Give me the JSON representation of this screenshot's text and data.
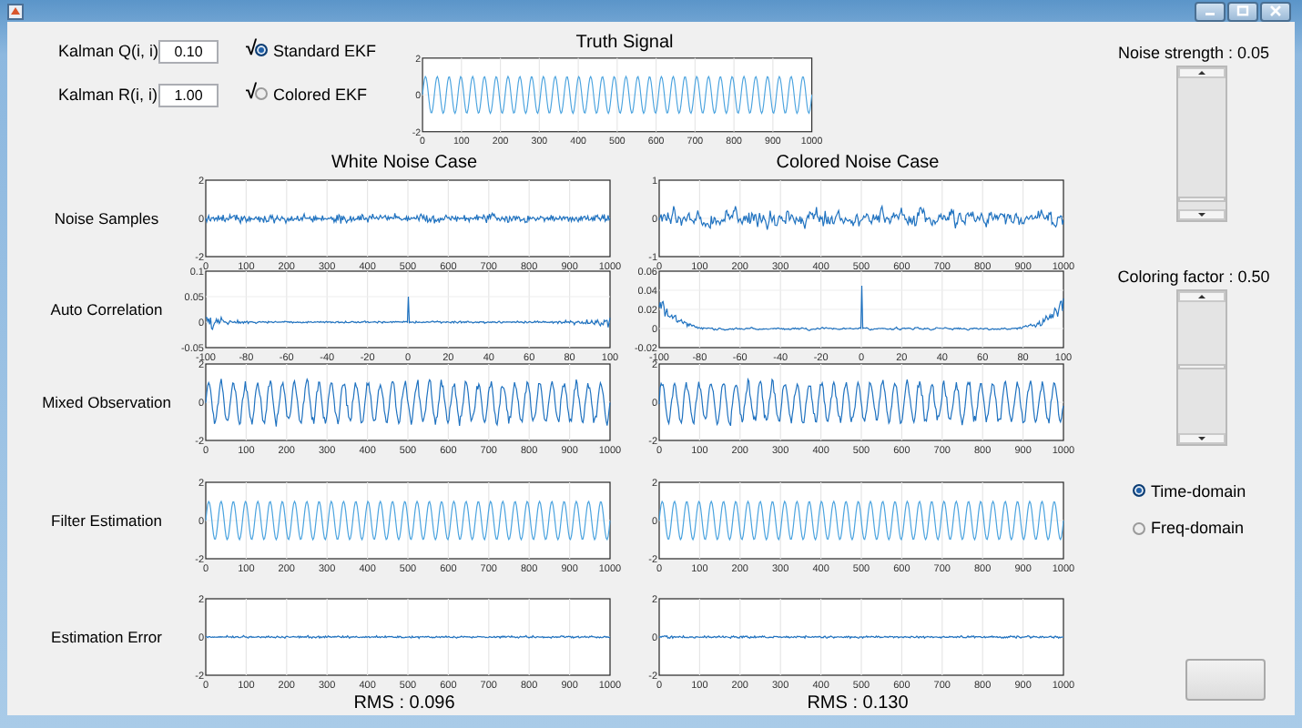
{
  "settings": [
    {
      "label": "Kalman Q(i, i)",
      "value": "0.10",
      "mark": "√"
    },
    {
      "label": "Kalman R(i, i)",
      "value": "1.00",
      "mark": "√"
    }
  ],
  "filter_options": [
    {
      "label": "Standard EKF",
      "selected": true
    },
    {
      "label": "Colored  EKF",
      "selected": false
    }
  ],
  "truth_plot": {
    "title": "Truth Signal",
    "kind": "sine",
    "yticks": [
      "2",
      "0",
      "-2"
    ],
    "xticks": [
      "0",
      "100",
      "200",
      "300",
      "400",
      "500",
      "600",
      "700",
      "800",
      "900",
      "1000"
    ]
  },
  "cases": [
    {
      "title": "White Noise Case",
      "rms": "RMS : 0.096"
    },
    {
      "title": "Colored Noise Case",
      "rms": "RMS : 0.130"
    }
  ],
  "rows": [
    {
      "label": "Noise Samples",
      "plots": [
        {
          "kind": "white_noise",
          "yticks": [
            "2",
            "0",
            "-2"
          ],
          "xticks": [
            "0",
            "100",
            "200",
            "300",
            "400",
            "500",
            "600",
            "700",
            "800",
            "900",
            "1000"
          ]
        },
        {
          "kind": "colored_noise",
          "yticks": [
            "1",
            "0",
            "-1"
          ],
          "xticks": [
            "0",
            "100",
            "200",
            "300",
            "400",
            "500",
            "600",
            "700",
            "800",
            "900",
            "1000"
          ]
        }
      ]
    },
    {
      "label": "Auto Correlation",
      "plots": [
        {
          "kind": "autocorr_white",
          "yticks": [
            "0.1",
            "0.05",
            "0",
            "-0.05"
          ],
          "xticks": [
            "-100",
            "-80",
            "-60",
            "-40",
            "-20",
            "0",
            "20",
            "40",
            "60",
            "80",
            "100"
          ]
        },
        {
          "kind": "autocorr_colored",
          "yticks": [
            "0.06",
            "0.04",
            "0.02",
            "0",
            "-0.02"
          ],
          "xticks": [
            "-100",
            "-80",
            "-60",
            "-40",
            "-20",
            "0",
            "20",
            "40",
            "60",
            "80",
            "100"
          ]
        }
      ]
    },
    {
      "label": "Mixed Observation",
      "plots": [
        {
          "kind": "mixed",
          "yticks": [
            "2",
            "0",
            "-2"
          ],
          "xticks": [
            "0",
            "100",
            "200",
            "300",
            "400",
            "500",
            "600",
            "700",
            "800",
            "900",
            "1000"
          ]
        },
        {
          "kind": "mixed",
          "yticks": [
            "2",
            "0",
            "-2"
          ],
          "xticks": [
            "0",
            "100",
            "200",
            "300",
            "400",
            "500",
            "600",
            "700",
            "800",
            "900",
            "1000"
          ]
        }
      ]
    },
    {
      "label": "Filter Estimation",
      "plots": [
        {
          "kind": "sine",
          "yticks": [
            "2",
            "0",
            "-2"
          ],
          "xticks": [
            "0",
            "100",
            "200",
            "300",
            "400",
            "500",
            "600",
            "700",
            "800",
            "900",
            "1000"
          ]
        },
        {
          "kind": "sine",
          "yticks": [
            "2",
            "0",
            "-2"
          ],
          "xticks": [
            "0",
            "100",
            "200",
            "300",
            "400",
            "500",
            "600",
            "700",
            "800",
            "900",
            "1000"
          ]
        }
      ]
    },
    {
      "label": "Estimation Error",
      "plots": [
        {
          "kind": "error",
          "yticks": [
            "2",
            "0",
            "-2"
          ],
          "xticks": [
            "0",
            "100",
            "200",
            "300",
            "400",
            "500",
            "600",
            "700",
            "800",
            "900",
            "1000"
          ]
        },
        {
          "kind": "error",
          "yticks": [
            "2",
            "0",
            "-2"
          ],
          "xticks": [
            "0",
            "100",
            "200",
            "300",
            "400",
            "500",
            "600",
            "700",
            "800",
            "900",
            "1000"
          ]
        }
      ]
    }
  ],
  "sliders": [
    {
      "label": "Noise strength : 0.05",
      "level": 0.05
    },
    {
      "label": "Coloring factor : 0.50",
      "level": 0.5
    }
  ],
  "domain_options": [
    {
      "label": "Time-domain",
      "selected": true
    },
    {
      "label": "Freq-domain",
      "selected": false
    }
  ],
  "action_button": {
    "kind": "button"
  }
}
